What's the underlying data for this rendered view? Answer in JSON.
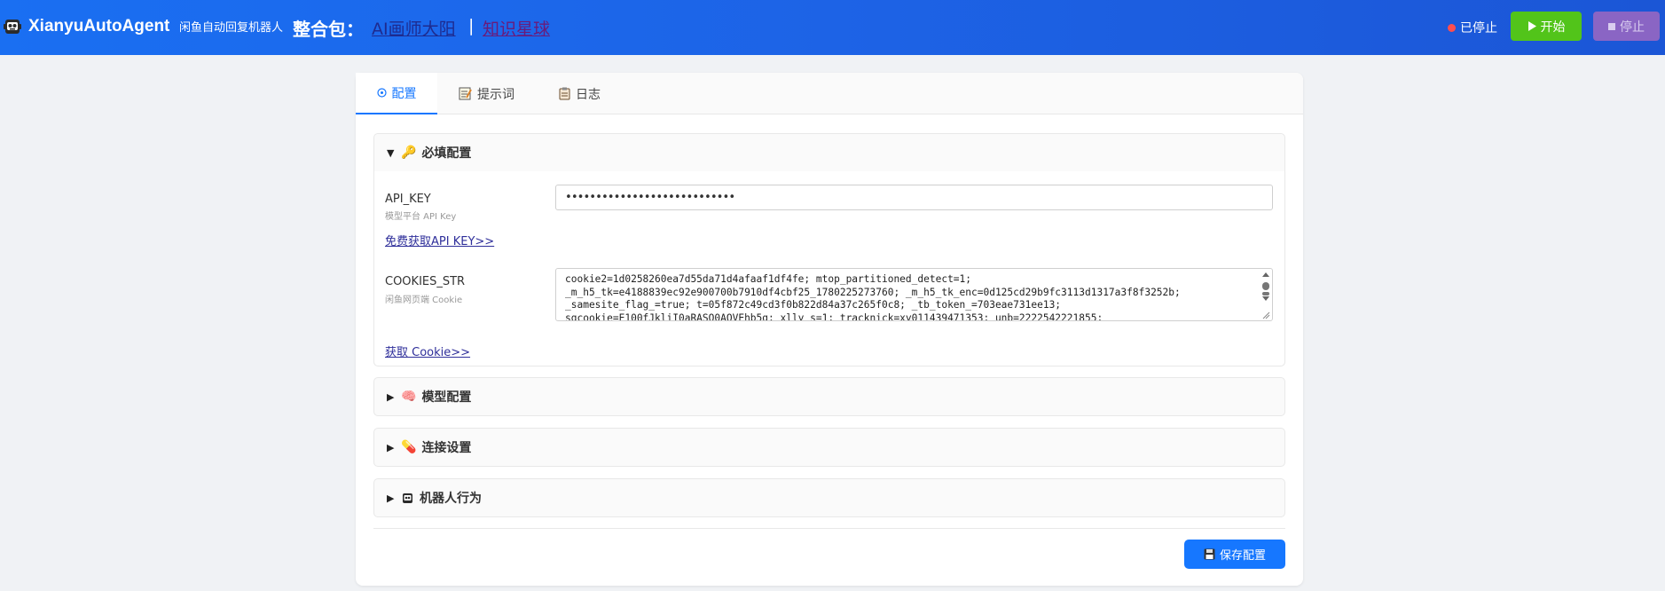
{
  "header": {
    "app_title": "XianyuAutoAgent",
    "app_subtitle": "闲鱼自动回复机器人",
    "bundle_label": "整合包：",
    "link_ai": "AI画师大阳",
    "separator": "|",
    "link_star": "知识星球",
    "status_text": "已停止",
    "start_label": "开始",
    "stop_label": "停止"
  },
  "tabs": [
    {
      "label": "配置",
      "icon": "gear-icon"
    },
    {
      "label": "提示词",
      "icon": "memo-icon"
    },
    {
      "label": "日志",
      "icon": "clipboard-icon"
    }
  ],
  "sections": {
    "required": {
      "title": "必填配置",
      "icon": "key-icon",
      "expanded": true,
      "api_key": {
        "label": "API_KEY",
        "hint": "模型平台 API Key",
        "value": "••••••••••••••••••••••••••••",
        "link": "免费获取API KEY>>"
      },
      "cookies": {
        "label": "COOKIES_STR",
        "hint": "闲鱼网页端 Cookie",
        "lines": [
          "cookie2=1d0258260ea7d55da71d4afaaf1df4fe; mtop_partitioned_detect=1;",
          "_m_h5_tk=e4188839ec92e900700b7910df4cbf25_1780225273760; _m_h5_tk_enc=0d125cd29b9fc3113d1317a3f8f3252b;",
          "_samesite_flag_=true; t=05f872c49cd3f0b822d84a37c265f0c8; _tb_token_=703eae731ee13;",
          "sgcookie=E100fJkliI0aRASQ0AQVEhb5g; xlly_s=1; tracknick=xy011439471353; unb=2222542221855;"
        ],
        "link": "获取 Cookie>>"
      }
    },
    "model": {
      "title": "模型配置",
      "icon": "brain-icon",
      "expanded": false
    },
    "connection": {
      "title": "连接设置",
      "icon": "pill-icon",
      "expanded": false
    },
    "bot": {
      "title": "机器人行为",
      "icon": "robot-icon",
      "expanded": false
    }
  },
  "footer": {
    "save_label": "保存配置",
    "save_icon": "floppy-icon"
  },
  "colors": {
    "header_bg": "#1d63e6",
    "accent": "#1677ff",
    "start_green": "#52c41a",
    "stop_purple": "#8a65c4",
    "status_red": "#ff4d4f"
  }
}
